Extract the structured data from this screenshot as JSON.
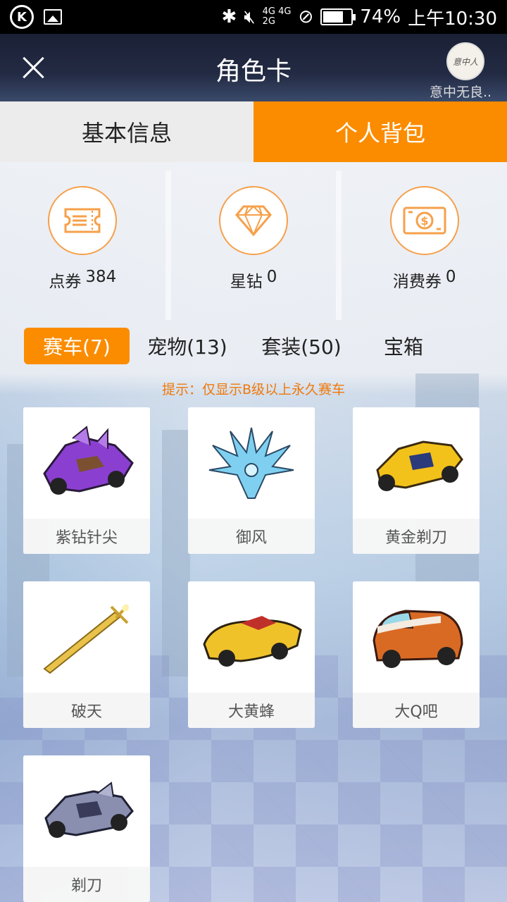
{
  "status_bar": {
    "net_top": "4G 4G",
    "net_bottom": "2G",
    "battery_percent": "74%",
    "time": "上午10:30",
    "battery_level": 0.74
  },
  "header": {
    "title": "角色卡",
    "user_name": "意中无良..",
    "avatar_text": "意中人"
  },
  "main_tabs": [
    {
      "label": "基本信息",
      "active": false
    },
    {
      "label": "个人背包",
      "active": true
    }
  ],
  "currency": [
    {
      "name": "点券",
      "value": "384",
      "icon": "ticket-icon"
    },
    {
      "name": "星钻",
      "value": "0",
      "icon": "diamond-icon"
    },
    {
      "name": "消费券",
      "value": "0",
      "icon": "banknote-icon"
    }
  ],
  "category_tabs": [
    {
      "label": "赛车(7)",
      "active": true
    },
    {
      "label": "宠物(13)",
      "active": false
    },
    {
      "label": "套装(50)",
      "active": false
    },
    {
      "label": "宝箱",
      "active": false
    }
  ],
  "tip": "提示：仅显示B级以上永久赛车",
  "items": [
    {
      "name": "紫钻针尖",
      "icon": "purple-kart-icon"
    },
    {
      "name": "御风",
      "icon": "ice-wing-icon"
    },
    {
      "name": "黄金剃刀",
      "icon": "gold-kart-icon"
    },
    {
      "name": "破天",
      "icon": "golden-sword-icon"
    },
    {
      "name": "大黄蜂",
      "icon": "yellow-car-icon"
    },
    {
      "name": "大Q吧",
      "icon": "orange-van-icon"
    },
    {
      "name": "剃刀",
      "icon": "silver-kart-icon"
    }
  ],
  "colors": {
    "accent": "#fb8c00",
    "tip": "#f0780a"
  }
}
